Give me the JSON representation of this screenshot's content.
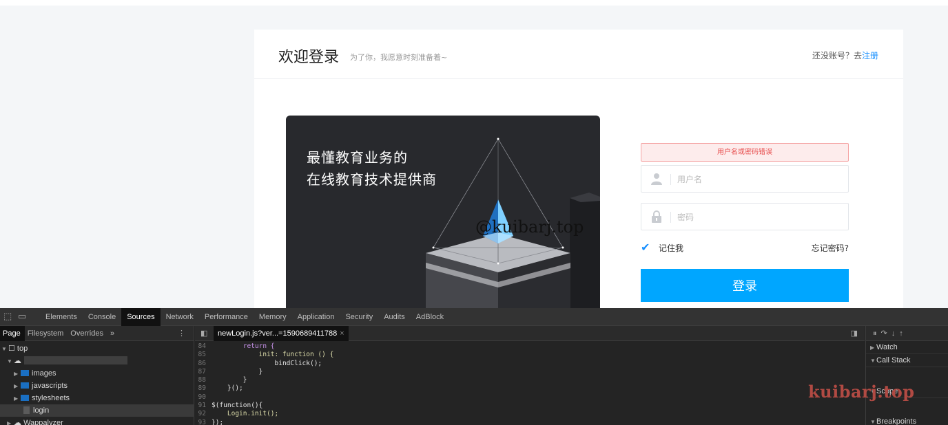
{
  "login": {
    "title": "欢迎登录",
    "subtitle": "为了你，我愿意时刻准备着~",
    "no_account_text": "还没账号？去",
    "register_link": "注册",
    "banner_line1": "最懂教育业务的",
    "banner_line2": "在线教育技术提供商",
    "error_message": "用户名或密码错误",
    "username_placeholder": "用户名",
    "password_placeholder": "密码",
    "remember_label": "记住我",
    "remember_checked": true,
    "forgot_label": "忘记密码?",
    "login_button": "登录",
    "accent_color": "#00a6ff",
    "error_color": "#e74c4c"
  },
  "watermarks": {
    "banner": "@kuibarj.top",
    "devtools": "kuibarj.top"
  },
  "devtools": {
    "main_tabs": [
      "Elements",
      "Console",
      "Sources",
      "Network",
      "Performance",
      "Memory",
      "Application",
      "Security",
      "Audits",
      "AdBlock"
    ],
    "active_tab": "Sources",
    "left_tabs": [
      "Page",
      "Filesystem",
      "Overrides",
      "»"
    ],
    "active_left_tab": "Page",
    "tree": {
      "top": "top",
      "folders": [
        "images",
        "javascripts",
        "stylesheets"
      ],
      "file": "login",
      "extension": "Wappalyzer"
    },
    "open_file": "newLogin.js?ver...=1590689411788",
    "code_lines": [
      {
        "num": "84",
        "text": "        return {"
      },
      {
        "num": "85",
        "text": "            init: function () {"
      },
      {
        "num": "86",
        "text": "                bindClick();"
      },
      {
        "num": "87",
        "text": "            }"
      },
      {
        "num": "88",
        "text": "        }"
      },
      {
        "num": "89",
        "text": "    }();"
      },
      {
        "num": "90",
        "text": ""
      },
      {
        "num": "91",
        "text": "$(function(){"
      },
      {
        "num": "92",
        "text": "    Login.init();"
      },
      {
        "num": "93",
        "text": "});"
      }
    ],
    "right_sections": [
      "Watch",
      "Call Stack",
      "Scope",
      "Breakpoints"
    ]
  }
}
